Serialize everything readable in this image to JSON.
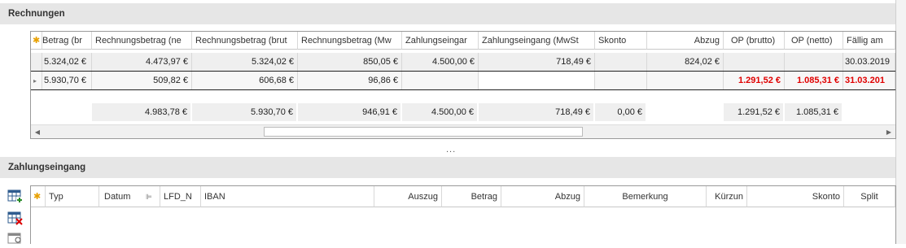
{
  "rechnungen": {
    "title": "Rechnungen",
    "columns": [
      "Betrag (br",
      "Rechnungsbetrag (ne",
      "Rechnungsbetrag (brut",
      "Rechnungsbetrag (Mw",
      "Zahlungseingar",
      "Zahlungseingang (MwSt",
      "Skonto",
      "Abzug",
      "OP (brutto)",
      "OP (netto)",
      "Fällig am"
    ],
    "rows": [
      [
        "5.324,02 €",
        "4.473,97 €",
        "5.324,02 €",
        "850,05 €",
        "4.500,00 €",
        "718,49 €",
        "",
        "824,02 €",
        "",
        "",
        "30.03.2019"
      ],
      [
        "5.930,70 €",
        "509,82 €",
        "606,68 €",
        "96,86 €",
        "",
        "",
        "",
        "",
        "1.291,52 €",
        "1.085,31 €",
        "31.03.201"
      ]
    ],
    "totals": [
      "",
      "4.983,78 €",
      "5.930,70 €",
      "946,91 €",
      "4.500,00 €",
      "718,49 €",
      "0,00 €",
      "",
      "1.291,52 €",
      "1.085,31 €",
      ""
    ]
  },
  "splitter": "...",
  "zahlungseingang": {
    "title": "Zahlungseingang",
    "columns": [
      "Typ",
      "Datum",
      "LFD_N",
      "IBAN",
      "Auszug",
      "Betrag",
      "Abzug",
      "Bemerkung",
      "Kürzun",
      "Skonto",
      "Split"
    ]
  },
  "colors": {
    "header_bg": "#e6e6e6",
    "overdue_red": "#e00000",
    "new_row_star": "#e8a000"
  },
  "icons": [
    "new-row-star-icon",
    "current-row-indicator-icon",
    "sort-icon",
    "add-row-icon",
    "delete-row-icon",
    "search-row-icon"
  ]
}
